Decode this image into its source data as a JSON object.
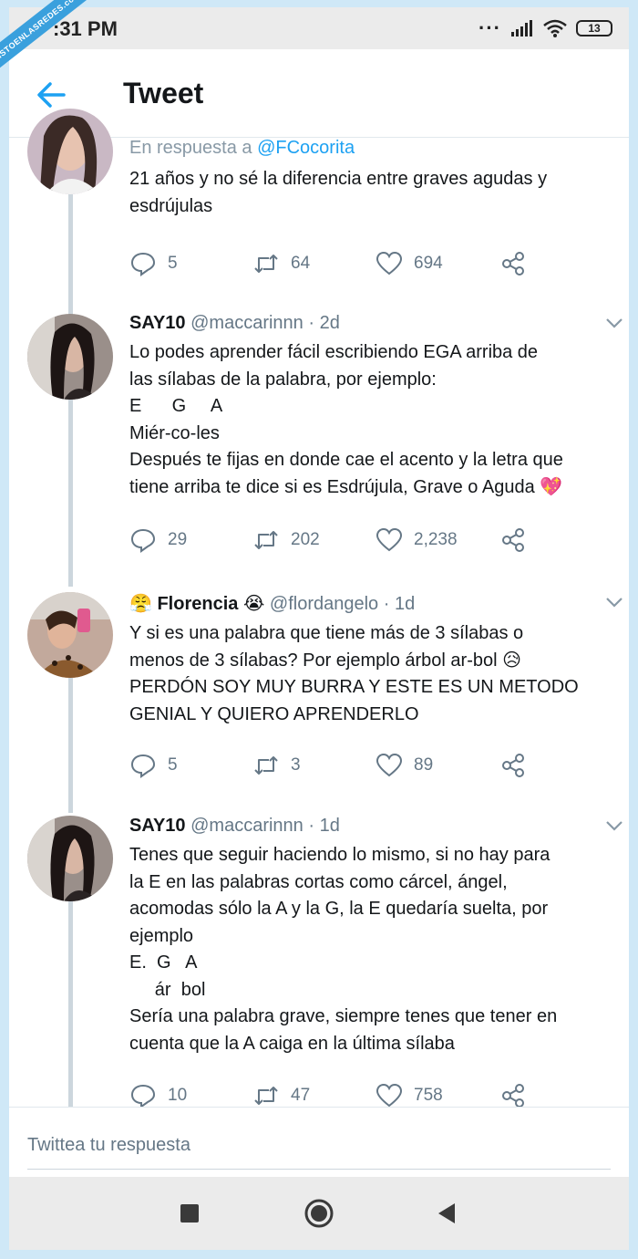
{
  "status_bar": {
    "time": ":31 PM",
    "battery": "13"
  },
  "watermark": "VISTOENLASREDES.com",
  "header": {
    "title": "Tweet"
  },
  "tweets": [
    {
      "reply_prefix": "En respuesta a ",
      "reply_handle": "@FCocorita",
      "text": "21 años y no sé la diferencia entre graves agudas y\nesdrújulas",
      "replies": "5",
      "retweets": "64",
      "likes": "694"
    },
    {
      "name": "SAY10",
      "handle": "@maccarinnn",
      "time": "· 2d",
      "text": "Lo podes aprender fácil escribiendo EGA arriba de\nlas sílabas de la palabra, por ejemplo:\nE      G     A\nMiér-co-les\nDespués te fijas en donde cae el acento y la letra que\ntiene arriba te dice si es Esdrújula, Grave o Aguda 💖",
      "replies": "29",
      "retweets": "202",
      "likes": "2,238"
    },
    {
      "name_prefix": "😤 ",
      "name": "Florencia",
      "name_suffix": " 😭",
      "handle": "@flordangelo",
      "time": "· 1d",
      "text": "Y si es una palabra que tiene más de 3 sílabas o\nmenos de 3 sílabas? Por ejemplo árbol ar-bol 😥\nPERDÓN SOY MUY BURRA Y ESTE ES UN METODO\nGENIAL Y QUIERO APRENDERLO",
      "replies": "5",
      "retweets": "3",
      "likes": "89"
    },
    {
      "name": "SAY10",
      "handle": "@maccarinnn",
      "time": "· 1d",
      "text": "Tenes que seguir haciendo lo mismo, si no hay para\nla E en las palabras cortas como cárcel, ángel,\nacomodas sólo la A y la G, la E quedaría suelta, por\nejemplo\nE.  G   A\n     ár  bol\nSería una palabra grave, siempre tenes que tener en\ncuenta que la A caiga en la última sílaba",
      "replies": "10",
      "retweets": "47",
      "likes": "758"
    }
  ],
  "reply_bar": {
    "placeholder": "Twittea tu respuesta"
  },
  "colors": {
    "accent": "#1da1f2",
    "muted": "#657786",
    "thread_line": "#ccd6dd"
  }
}
